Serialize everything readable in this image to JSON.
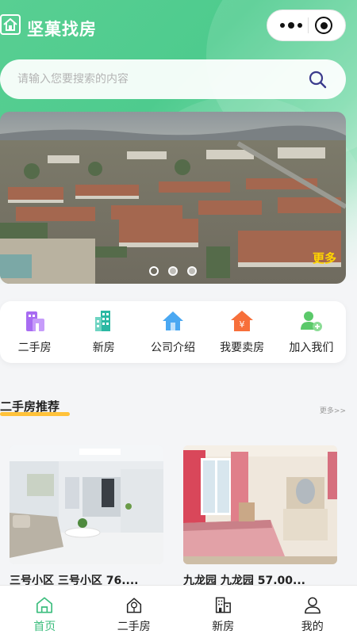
{
  "header": {
    "app_title": "坚菓找房"
  },
  "capsule": {
    "menu_icon": "more-dots-icon",
    "close_icon": "target-circle-icon"
  },
  "search": {
    "placeholder": "请输入您要搜索的内容",
    "value": ""
  },
  "banner": {
    "more_label": "更多",
    "slide_count": 3,
    "active_slide": 1
  },
  "quick_nav": [
    {
      "label": "二手房",
      "icon": "building-house-icon",
      "color": "#a86cf2"
    },
    {
      "label": "新房",
      "icon": "tall-building-icon",
      "color": "#2bb8a3"
    },
    {
      "label": "公司介绍",
      "icon": "home-icon",
      "color": "#4aa8f2"
    },
    {
      "label": "我要卖房",
      "icon": "sell-house-icon",
      "color": "#f76f3a"
    },
    {
      "label": "加入我们",
      "icon": "add-user-icon",
      "color": "#5bc96a"
    }
  ],
  "section": {
    "title": "二手房推荐",
    "more_label": "更多>>"
  },
  "listings": [
    {
      "caption": "三号小区 三号小区 76...."
    },
    {
      "caption": "九龙园 九龙园 57.00..."
    }
  ],
  "tabbar": [
    {
      "label": "首页",
      "icon": "home-tab-icon",
      "active": true
    },
    {
      "label": "二手房",
      "icon": "house-tree-icon",
      "active": false
    },
    {
      "label": "新房",
      "icon": "building-tab-icon",
      "active": false
    },
    {
      "label": "我的",
      "icon": "user-tab-icon",
      "active": false
    }
  ],
  "colors": {
    "brand_green": "#4ecb8e",
    "accent_yellow": "#ffc23a",
    "active_tab": "#3bbd7d"
  }
}
